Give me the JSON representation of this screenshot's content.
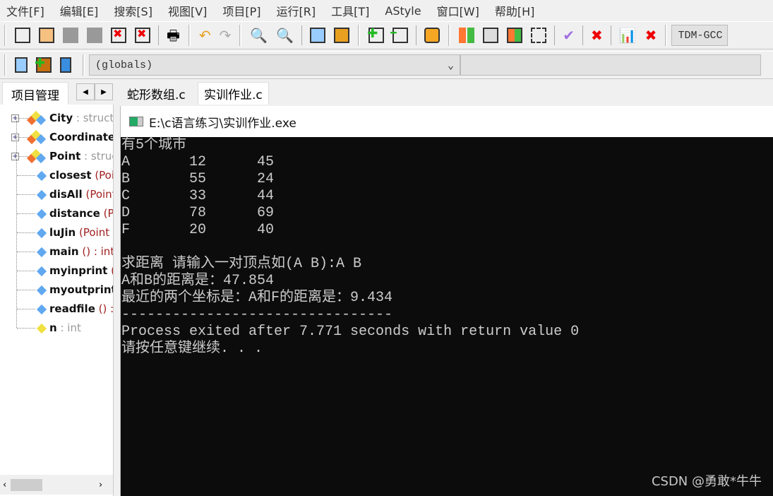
{
  "menu": [
    "文件[F]",
    "编辑[E]",
    "搜索[S]",
    "视图[V]",
    "项目[P]",
    "运行[R]",
    "工具[T]",
    "AStyle",
    "窗口[W]",
    "帮助[H]"
  ],
  "toolbar": {
    "scope_combo": "(globals)",
    "compiler_combo": "TDM-GCC"
  },
  "left_tab": "项目管理",
  "editor_tabs": [
    "蛇形数组.c",
    "实训作业.c"
  ],
  "tree": [
    {
      "name": "City",
      "detail": " : struct",
      "kind": "struct",
      "expandable": true
    },
    {
      "name": "Coordinate",
      "detail": "",
      "kind": "struct",
      "expandable": true
    },
    {
      "name": "Point",
      "detail": " : struct",
      "kind": "struct",
      "expandable": true
    },
    {
      "name": "closest",
      "detail": " (Point",
      "kind": "func"
    },
    {
      "name": "disAll",
      "detail": " (Point",
      "kind": "func"
    },
    {
      "name": "distance",
      "detail": " (P",
      "kind": "func"
    },
    {
      "name": "luJin",
      "detail": " (Point",
      "kind": "func"
    },
    {
      "name": "main",
      "detail": " () : int",
      "kind": "func"
    },
    {
      "name": "myinprint",
      "detail": " (",
      "kind": "func"
    },
    {
      "name": "myoutprint",
      "detail": "",
      "kind": "func"
    },
    {
      "name": "readfile",
      "detail": " () :",
      "kind": "func"
    },
    {
      "name": "n",
      "detail": " : int",
      "kind": "var"
    }
  ],
  "console": {
    "title": "E:\\c语言练习\\实训作业.exe",
    "lines": [
      "有5个城市",
      "A\t12\t45",
      "B\t55\t24",
      "C\t33\t44",
      "D\t78\t69",
      "F\t20\t40",
      "",
      "求距离 请输入一对顶点如(A B):A B",
      "A和B的距离是：47.854",
      "最近的两个坐标是：A和F的距离是：9.434",
      "--------------------------------",
      "Process exited after 7.771 seconds with return value 0",
      "请按任意键继续. . ."
    ]
  },
  "watermark": "CSDN @勇敢*牛牛"
}
